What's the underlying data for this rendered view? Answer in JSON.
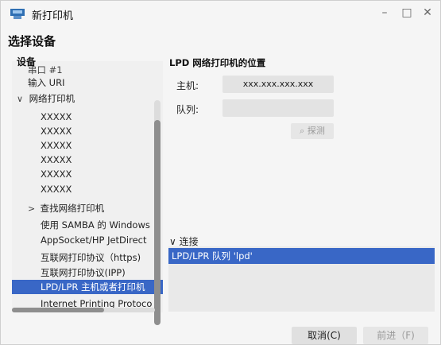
{
  "window": {
    "title": "新打印机",
    "minimize": "–",
    "maximize": "□",
    "close": "✕"
  },
  "page": {
    "heading": "选择设备",
    "device_label": "设备"
  },
  "tree": {
    "items": [
      {
        "label": "串口 #1",
        "partial": true
      },
      {
        "label": "输入 URI"
      },
      {
        "label": "网络打印机",
        "expander": "∨"
      },
      {
        "label": "XXXXX"
      },
      {
        "label": "XXXXX"
      },
      {
        "label": "XXXXX"
      },
      {
        "label": "XXXXX"
      },
      {
        "label": "XXXXX"
      },
      {
        "label": "XXXXX"
      },
      {
        "label": "查找网络打印机",
        "expander": ">"
      },
      {
        "label": "使用 SAMBA 的 Windows"
      },
      {
        "label": "AppSocket/HP JetDirect"
      },
      {
        "label": "互联网打印协议（https)"
      },
      {
        "label": "互联网打印协议(IPP)"
      },
      {
        "label": "LPD/LPR 主机或者打印机",
        "selected": true
      },
      {
        "label": "Internet Printing Protoco"
      }
    ]
  },
  "detail": {
    "title": "LPD 网络打印机的位置",
    "host_label": "主机:",
    "host_value": "xxx.xxx.xxx.xxx",
    "queue_label": "队列:",
    "queue_value": "",
    "probe_label": "探测",
    "connection_label": "连接",
    "connection_expander": "∨",
    "connections": [
      "LPD/LPR 队列 'lpd'"
    ]
  },
  "buttons": {
    "cancel": "取消(C)",
    "forward": "前进（F)"
  },
  "colors": {
    "selection": "#3967c6",
    "background": "#f5f5f5"
  }
}
